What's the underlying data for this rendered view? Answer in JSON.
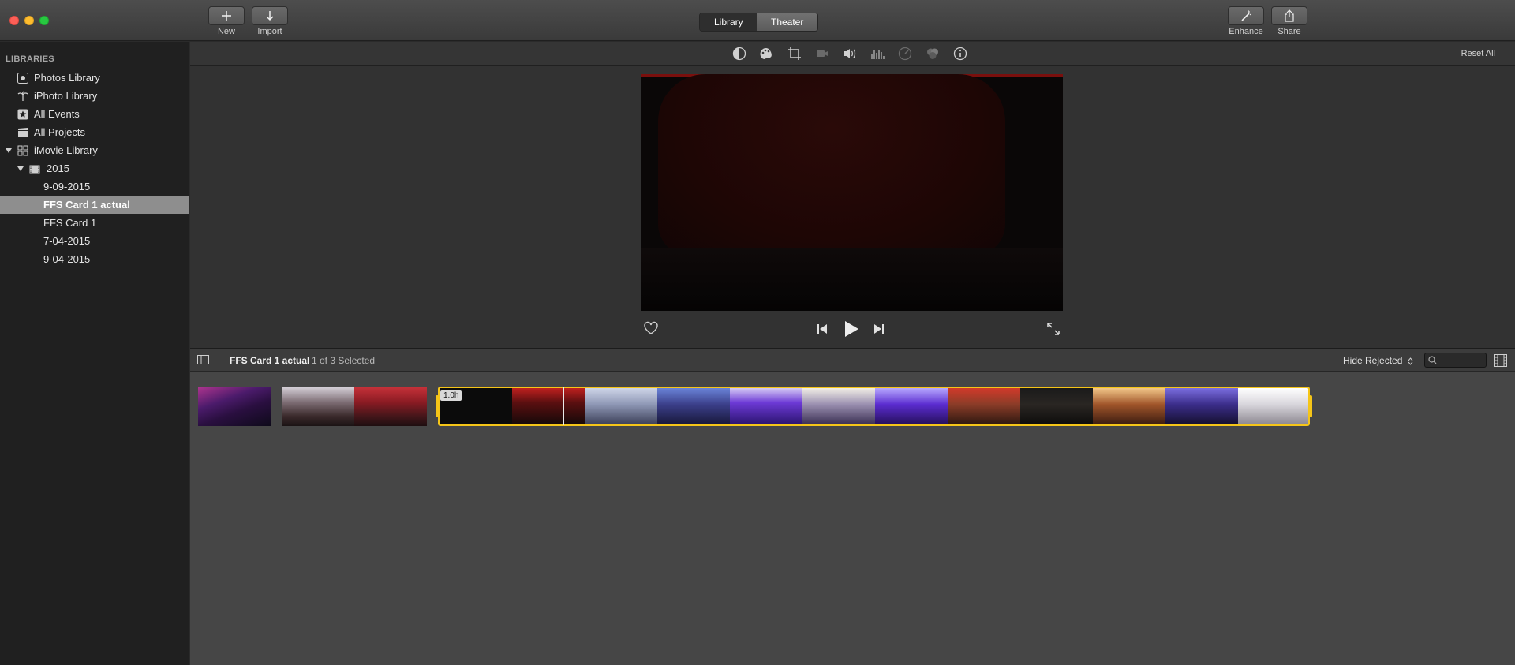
{
  "window": {
    "toolbar": {
      "new_label": "New",
      "import_label": "Import",
      "enhance_label": "Enhance",
      "share_label": "Share",
      "view_tabs": [
        {
          "label": "Library",
          "active": true
        },
        {
          "label": "Theater",
          "active": false
        }
      ]
    }
  },
  "sidebar": {
    "heading": "LIBRARIES",
    "items": [
      {
        "label": "Photos Library",
        "icon": "photos-icon"
      },
      {
        "label": "iPhoto Library",
        "icon": "palm-tree-icon"
      },
      {
        "label": "All Events",
        "icon": "star-icon"
      },
      {
        "label": "All Projects",
        "icon": "clapper-icon"
      },
      {
        "label": "iMovie Library",
        "icon": "grid-icon",
        "expanded": true
      },
      {
        "label": "2015",
        "icon": "film-folder-icon",
        "expanded": true
      },
      {
        "label": "9-09-2015"
      },
      {
        "label": "FFS Card 1 actual",
        "selected": true
      },
      {
        "label": "FFS Card 1"
      },
      {
        "label": "7-04-2015"
      },
      {
        "label": "9-04-2015"
      }
    ]
  },
  "adjust_bar": {
    "icons": [
      "color-balance-icon",
      "color-correction-icon",
      "crop-icon",
      "stabilization-icon",
      "volume-icon",
      "noise-reduction-icon",
      "speed-icon",
      "clip-filter-icon",
      "info-icon"
    ],
    "reset_label": "Reset All"
  },
  "browser": {
    "event_title": "FFS Card 1 actual",
    "selection_count": "1 of 3 Selected",
    "filter_label": "Hide Rejected",
    "search_placeholder": "",
    "selected_clip_duration": "1.0h"
  },
  "colors": {
    "selection_yellow": "#f5c518",
    "sidebar_selected": "#8e8e8e",
    "close": "#fc5f57",
    "minimize": "#fdbc2e",
    "zoom": "#27c840"
  }
}
